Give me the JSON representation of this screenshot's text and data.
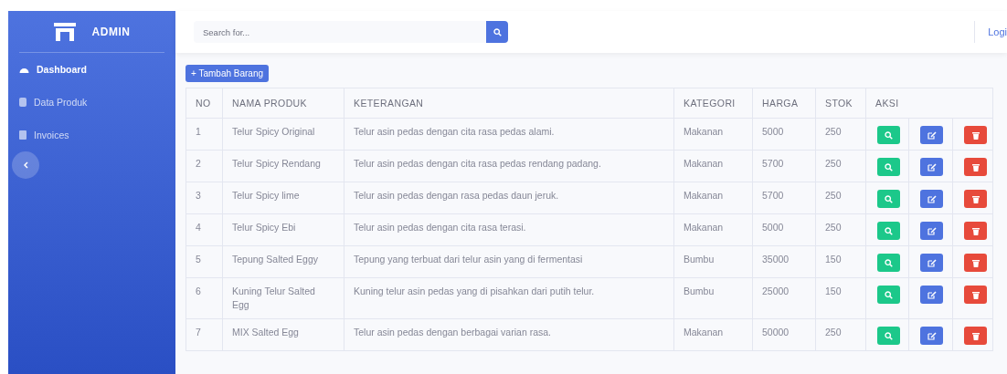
{
  "sidebar": {
    "brand": "ADMIN",
    "items": [
      {
        "label": "Dashboard",
        "kind": "gauge",
        "selected": true
      },
      {
        "label": "Data Produk",
        "kind": "db",
        "selected": false
      },
      {
        "label": "Invoices",
        "kind": "file",
        "selected": false
      }
    ]
  },
  "topbar": {
    "search": {
      "placeholder": "Search for..."
    },
    "login": "Logi"
  },
  "add_button": "+ Tambah Barang",
  "table": {
    "columns": [
      "NO",
      "NAMA PRODUK",
      "KETERANGAN",
      "KATEGORI",
      "HARGA",
      "STOK",
      "AKSI"
    ],
    "rows": [
      [
        "1",
        "Telur Spicy Original",
        "Telur asin pedas dengan cita rasa pedas alami.",
        "Makanan",
        "5000",
        "250"
      ],
      [
        "2",
        "Telur Spicy Rendang",
        "Telur asin pedas dengan cita rasa pedas rendang padang.",
        "Makanan",
        "5700",
        "250"
      ],
      [
        "3",
        "Telur Spicy lime",
        "Telur asin pedas dengan rasa pedas daun jeruk.",
        "Makanan",
        "5700",
        "250"
      ],
      [
        "4",
        "Telur Spicy Ebi",
        "Telur asin pedas dengan cita rasa terasi.",
        "Makanan",
        "5000",
        "250"
      ],
      [
        "5",
        "Tepung Salted Eggy",
        "Tepung yang terbuat dari telur asin yang di fermentasi",
        "Bumbu",
        "35000",
        "150"
      ],
      [
        "6",
        "Kuning Telur Salted Egg",
        "Kuning telur asin pedas yang di pisahkan dari putih telur.",
        "Bumbu",
        "25000",
        "150"
      ],
      [
        "7",
        "MIX Salted Egg",
        "Telur asin pedas dengan berbagai varian rasa.",
        "Makanan",
        "50000",
        "250"
      ]
    ]
  }
}
